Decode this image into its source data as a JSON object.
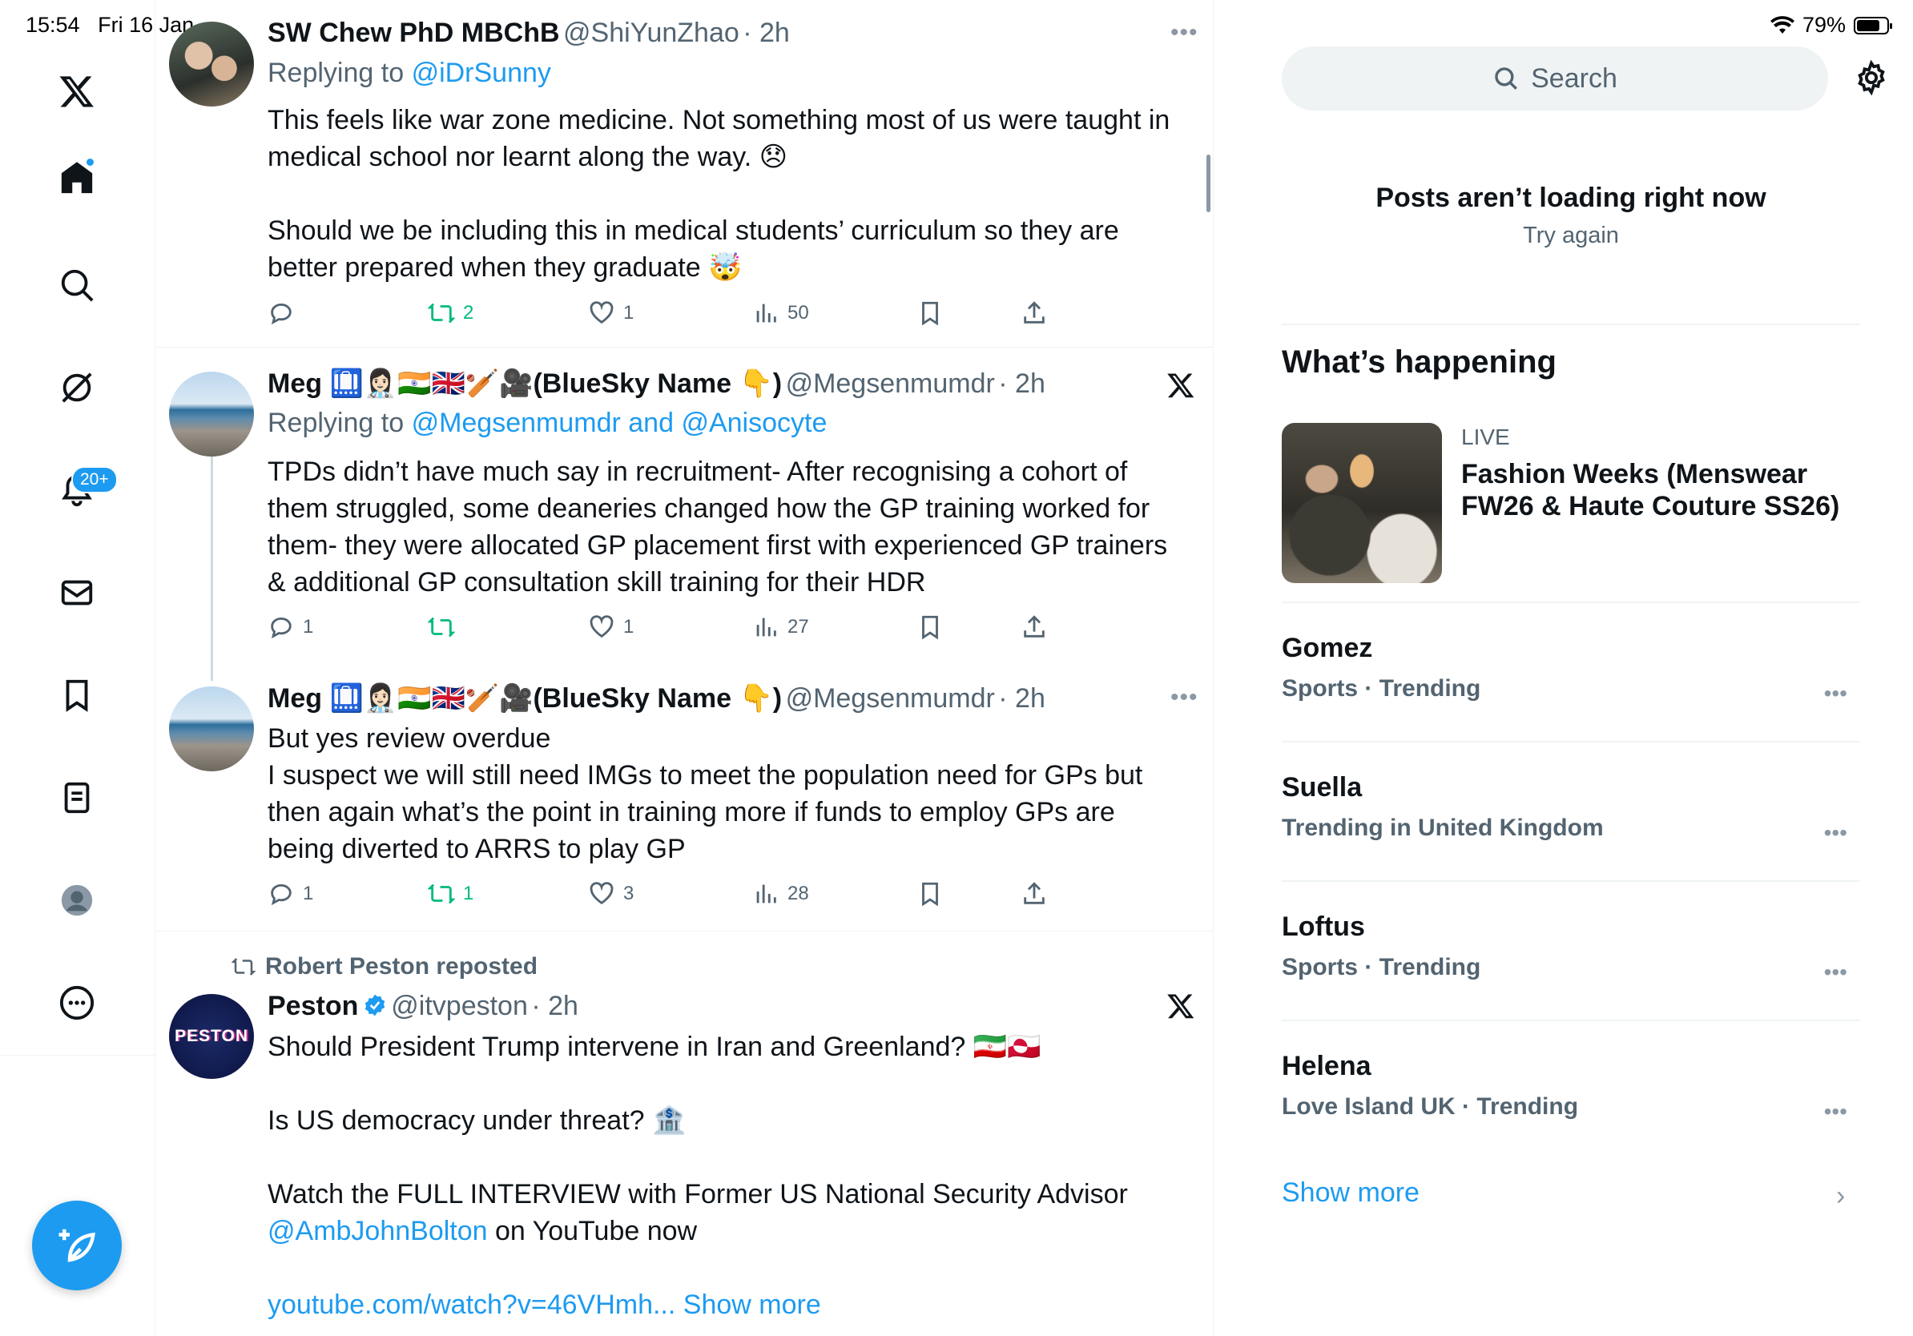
{
  "status_bar": {
    "time": "15:54",
    "date": "Fri 16 Jan",
    "battery": "79%"
  },
  "nav": {
    "notifications_badge": "20+"
  },
  "tweets": [
    {
      "name": "SW Chew PhD MBChB",
      "handle": "@ShiYunZhao",
      "time": "· 2h",
      "replying_prefix": "Replying to",
      "replying_to": "@iDrSunny",
      "lines": [
        "This feels like war zone medicine. Not something most of us were taught in",
        "medical school nor learnt along the way. 😞",
        "Should we be including this in   medical students’ curriculum so they are",
        "better prepared when they graduate 🤯"
      ],
      "replies": "",
      "reposts": "2",
      "likes": "1",
      "views": "50"
    },
    {
      "name": "Meg 🛄👩🏻‍⚕️🇮🇳🇬🇧🏏🎥(BlueSky Name 👇)",
      "handle": "@Megsenmumdr",
      "time": "· 2h",
      "replying_prefix": "Replying to",
      "replying_to": "@Megsenmumdr and @Anisocyte",
      "lines": [
        "TPDs didn’t have much say in recruitment- After recognising a cohort of",
        "them struggled, some deaneries changed how the GP training worked for",
        "them- they were allocated GP placement first with experienced GP trainers",
        "& additional GP consultation skill training for their HDR"
      ],
      "replies": "1",
      "reposts": "",
      "likes": "1",
      "views": "27"
    },
    {
      "name": "Meg 🛄👩🏻‍⚕️🇮🇳🇬🇧🏏🎥(BlueSky Name 👇)",
      "handle": "@Megsenmumdr",
      "time": "· 2h",
      "lines": [
        "But yes review overdue",
        "I suspect we will still need IMGs to meet the population need for GPs but",
        "then again what’s the point in training more if funds to employ GPs are",
        "being diverted to ARRS to play GP"
      ],
      "replies": "1",
      "reposts": "1",
      "likes": "3",
      "views": "28"
    },
    {
      "repost_label": "Robert Peston reposted",
      "name": "Peston",
      "avatar_text": "PESTON",
      "handle": "@itvpeston",
      "time": "· 2h",
      "line1": "Should President Trump intervene in Iran and Greenland? 🇮🇷🇬🇱",
      "line2": "Is US democracy under threat? 🏦",
      "line3": "Watch the FULL INTERVIEW with Former US National Security Advisor",
      "mention": "@AmbJohnBolton",
      "line4_rest": " on YouTube now",
      "url": "youtube.com/watch?v=46VHmh...",
      "show_more": " Show more"
    }
  ],
  "right": {
    "search_placeholder": "Search",
    "error_title": "Posts aren’t loading right now",
    "error_retry": "Try again",
    "whats_happening": "What’s happening",
    "live_label": "LIVE",
    "live_title_1": "Fashion Weeks (Menswear",
    "live_title_2": "FW26 & Haute Couture SS26)",
    "trends": [
      {
        "name": "Gomez",
        "meta": "Sports · Trending"
      },
      {
        "name": "Suella",
        "meta": "Trending in United Kingdom"
      },
      {
        "name": "Loftus",
        "meta": "Sports · Trending"
      },
      {
        "name": "Helena",
        "meta": "Love Island UK · Trending"
      }
    ],
    "show_more": "Show more"
  },
  "colors": {
    "accent": "#1d9bf0",
    "repost_green": "#00ba7c",
    "secondary_text": "#536471"
  }
}
